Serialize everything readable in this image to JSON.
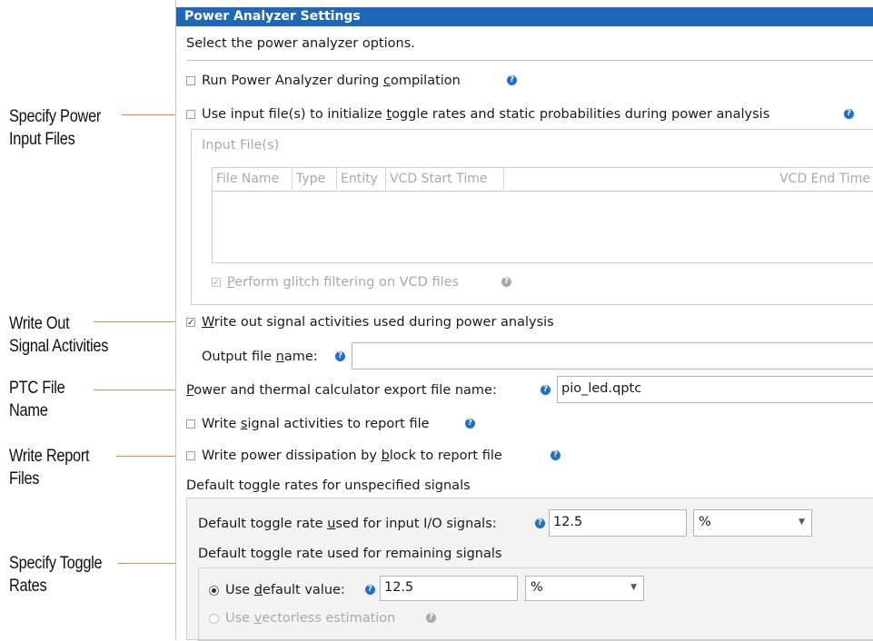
{
  "callouts": {
    "power_input": [
      "Specify Power",
      "Input Files"
    ],
    "signal_activities": [
      "Write Out",
      "Signal Activities"
    ],
    "ptc_file": [
      "PTC File",
      "Name"
    ],
    "report_files": [
      "Write Report",
      "Files"
    ],
    "toggle_rates": [
      "Specify Toggle",
      "Rates"
    ]
  },
  "panel": {
    "title": "Power Analyzer Settings",
    "description": "Select the power analyzer options.",
    "run_during_compilation": {
      "pre": "Run Power Analyzer during ",
      "mn": "c",
      "post": "ompilation",
      "checked": false
    },
    "use_input_files": {
      "pre": "Use input file(s) to initialize ",
      "mn": "t",
      "post": "oggle rates and static probabilities during power analysis",
      "checked": false
    },
    "input_files_group": {
      "label": "Input File(s)",
      "columns": [
        "File Name",
        "Type",
        "Entity",
        "VCD Start Time",
        "VCD End Time"
      ],
      "glitch_filtering": {
        "mn": "P",
        "post": "erform glitch filtering on VCD files",
        "checked": true
      }
    },
    "write_signal_activities": {
      "mn": "W",
      "post": "rite out signal activities used during power analysis",
      "checked": true
    },
    "output_file": {
      "pre": "Output file ",
      "mn": "n",
      "post": "ame:",
      "value": ""
    },
    "ptc_export": {
      "mn": "P",
      "post": "ower and thermal calculator export file name:",
      "value": "pio_led.qptc"
    },
    "write_to_report": {
      "pre": "Write ",
      "mn": "s",
      "post": "ignal activities to report file",
      "checked": false
    },
    "dissipation_by_block": {
      "pre": "Write power dissipation by ",
      "mn": "b",
      "post": "lock to report file",
      "checked": false
    },
    "toggle_group": {
      "label": "Default toggle rates for unspecified signals",
      "input_io": {
        "pre": "Default toggle rate ",
        "mn": "u",
        "post": "sed for input I/O signals:",
        "value": "12.5",
        "unit": "%"
      },
      "remaining_label": "Default toggle rate used for remaining signals",
      "use_default": {
        "pre": "Use ",
        "mn": "d",
        "post": "efault value:",
        "value": "12.5",
        "unit": "%",
        "selected": true
      },
      "use_vectorless": {
        "pre": "Use ",
        "mn": "v",
        "post": "ectorless estimation",
        "selected": false
      }
    }
  },
  "icons": {
    "help": "help-icon",
    "dropdown": "chevron-down-icon"
  },
  "colors": {
    "title_bar": "#1f68b9",
    "help_icon": "#1f6fd0",
    "leader_line": "#e8883a"
  }
}
